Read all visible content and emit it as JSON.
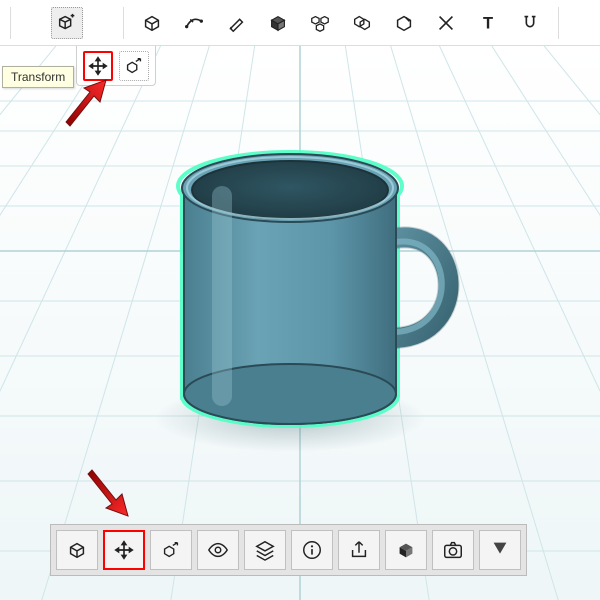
{
  "tooltip": {
    "label": "Transform"
  },
  "top_tools": [
    {
      "name": "select-tool",
      "icon": "cube-plus",
      "active": true
    },
    {
      "name": "create-tool",
      "icon": "cube-ring"
    },
    {
      "name": "sketch-tool",
      "icon": "sketch-curve"
    },
    {
      "name": "revolve-tool",
      "icon": "brush"
    },
    {
      "name": "primitive-tool",
      "icon": "cube"
    },
    {
      "name": "array-tool",
      "icon": "cubes-grid"
    },
    {
      "name": "combine-tool",
      "icon": "cubes-merge"
    },
    {
      "name": "modify-tool",
      "icon": "cube-edit"
    },
    {
      "name": "measure-tool",
      "icon": "cross-tools"
    },
    {
      "name": "text-tool",
      "icon": "text"
    },
    {
      "name": "snap-tool",
      "icon": "magnet"
    }
  ],
  "sub_tools": [
    {
      "name": "move-tool",
      "icon": "move-arrows",
      "highlight": true
    },
    {
      "name": "scale-tool",
      "icon": "cube-scale",
      "highlight": false
    }
  ],
  "bottom_tools": [
    {
      "name": "object-tool",
      "icon": "cube-ring"
    },
    {
      "name": "move-tool",
      "icon": "move-arrows",
      "highlight": true
    },
    {
      "name": "scale-tool",
      "icon": "cube-scale"
    },
    {
      "name": "visibility-tool",
      "icon": "eye"
    },
    {
      "name": "layers-tool",
      "icon": "layers"
    },
    {
      "name": "info-tool",
      "icon": "info"
    },
    {
      "name": "share-tool",
      "icon": "share"
    },
    {
      "name": "material-tool",
      "icon": "dark-cube"
    },
    {
      "name": "camera-tool",
      "icon": "camera"
    },
    {
      "name": "export-tool",
      "icon": "down-chevron"
    }
  ],
  "colors": {
    "mug": "#5c95a8",
    "mug_dark": "#3f6e7e",
    "mug_rim": "#2a4a55",
    "select_glow": "#4dffc4",
    "grid_major": "#b8d8dc",
    "grid_minor": "#d4e8ea",
    "bg_top": "#ffffff",
    "bg_bot": "#eef6f7"
  }
}
